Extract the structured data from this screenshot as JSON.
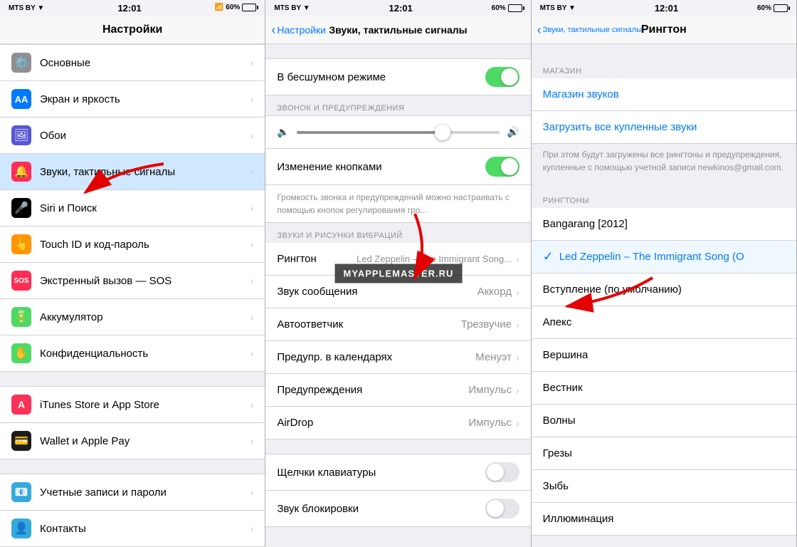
{
  "panel1": {
    "statusBar": {
      "carrier": "MTS BY ▼",
      "time": "12:01",
      "battery": "60%"
    },
    "navTitle": "Настройки",
    "items": [
      {
        "id": "general",
        "icon": "⚙️",
        "iconBg": "#8e8e93",
        "label": "Основные",
        "value": ""
      },
      {
        "id": "display",
        "icon": "AA",
        "iconBg": "#007aff",
        "label": "Экран и яркость",
        "value": ""
      },
      {
        "id": "wallpaper",
        "icon": "🖼",
        "iconBg": "#5856d6",
        "label": "Обои",
        "value": ""
      },
      {
        "id": "sounds",
        "icon": "🔔",
        "iconBg": "#ff2d55",
        "label": "Звуки, тактильные сигналы",
        "value": "",
        "highlighted": true
      },
      {
        "id": "siri",
        "icon": "🎤",
        "iconBg": "#000",
        "label": "Siri и Поиск",
        "value": ""
      },
      {
        "id": "touchid",
        "icon": "👆",
        "iconBg": "#ff9500",
        "label": "Touch ID и код-пароль",
        "value": ""
      },
      {
        "id": "sos",
        "icon": "SOS",
        "iconBg": "#ff2d55",
        "label": "Экстренный вызов — SOS",
        "value": ""
      },
      {
        "id": "battery",
        "icon": "🔋",
        "iconBg": "#4cd964",
        "label": "Аккумулятор",
        "value": ""
      },
      {
        "id": "privacy",
        "icon": "✋",
        "iconBg": "#4cd964",
        "label": "Конфиденциальность",
        "value": ""
      },
      {
        "id": "itunes",
        "icon": "A",
        "iconBg": "#fc3158",
        "label": "iTunes Store и App Store",
        "value": ""
      },
      {
        "id": "wallet",
        "icon": "💳",
        "iconBg": "#000",
        "label": "Wallet и Apple Pay",
        "value": ""
      },
      {
        "id": "accounts",
        "icon": "📧",
        "iconBg": "#34aadc",
        "label": "Учетные записи и пароли",
        "value": ""
      },
      {
        "id": "contacts",
        "icon": "👤",
        "iconBg": "#34aadc",
        "label": "Контакты",
        "value": ""
      }
    ]
  },
  "panel2": {
    "statusBar": {
      "carrier": "MTS BY ▼",
      "time": "12:01",
      "battery": "60%"
    },
    "navBack": "Настройки",
    "navTitle": "Звуки, тактильные сигналы",
    "silentMode": {
      "label": "В бесшумном режиме",
      "value": true
    },
    "sectionRinging": "ЗВОНОК И ПРЕДУПРЕЖДЕНИЯ",
    "sectionSounds": "ЗВУКИ И РИСУНКИ ВИБРАЦИЙ",
    "volumeButtons": {
      "label": "Изменение кнопками",
      "value": true
    },
    "volumeNote": "Громкость звонка и предупреждений можно настраивать с помощью кнопок регулирования гро...",
    "ringtone": {
      "label": "Рингтон",
      "value": "Led Zeppelin – The Immigrant Song..."
    },
    "messageTone": {
      "label": "Звук сообщения",
      "value": "Аккорд"
    },
    "autoAnswer": {
      "label": "Автоответчик",
      "value": "Трезвучие"
    },
    "calendarAlerts": {
      "label": "Предупр. в календарях",
      "value": "Менуэт"
    },
    "reminders": {
      "label": "Предупреждения",
      "value": "Импульс"
    },
    "airdrop": {
      "label": "AirDrop",
      "value": "Импульс"
    },
    "keyboardClicks": {
      "label": "Щелчки клавиатуры",
      "toggleOff": true
    },
    "lockSound": {
      "label": "Звук блокировки",
      "toggleOff": true
    },
    "watermark": "MYAPPLEMASTER.RU"
  },
  "panel3": {
    "statusBar": {
      "carrier": "MTS BY ▼",
      "time": "12:01",
      "battery": "60%"
    },
    "navBack": "Звуки, тактильные сигналы",
    "navTitle": "Рингтон",
    "sectionStore": "МАГАЗИН",
    "storeLink": "Магазин звуков",
    "downloadAll": "Загрузить все купленные звуки",
    "downloadNote": "При этом будут загружены все рингтоны и предупреждения, купленные с помощью учетной записи newkinos@gmail.com.",
    "sectionRingtones": "РИНГТОНЫ",
    "ringtones": [
      {
        "label": "Bangarang [2012]",
        "selected": false
      },
      {
        "label": "Led Zeppelin – The Immigrant Song (O",
        "selected": true
      },
      {
        "label": "Вступление (по умолчанию)",
        "selected": false
      },
      {
        "label": "Апекс",
        "selected": false
      },
      {
        "label": "Вершина",
        "selected": false
      },
      {
        "label": "Вестник",
        "selected": false
      },
      {
        "label": "Волны",
        "selected": false
      },
      {
        "label": "Грезы",
        "selected": false
      },
      {
        "label": "Зыбь",
        "selected": false
      },
      {
        "label": "Иллюминация",
        "selected": false
      }
    ]
  }
}
